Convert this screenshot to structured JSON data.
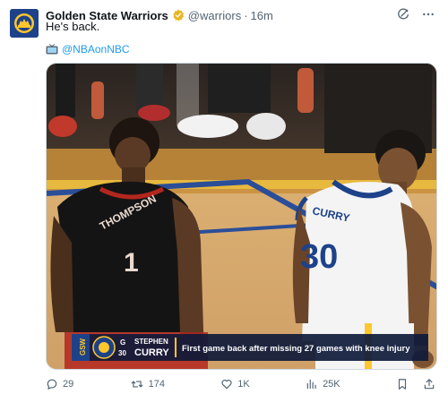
{
  "tweet": {
    "author_name": "Golden State Warriors",
    "author_handle": "@warriors",
    "separator": "·",
    "time": "16m",
    "text": "He's back.",
    "mention": "@NBAonNBC"
  },
  "media": {
    "player_left_name": "THOMPSON",
    "player_left_number": "1",
    "player_right_name": "CURRY",
    "player_right_number": "30",
    "team_tag": "GSW",
    "lower_third_position": "G",
    "lower_third_number": "30",
    "lower_third_first_name": "STEPHEN",
    "lower_third_last_name": "CURRY",
    "lower_third_caption": "First game back after missing 27 games with knee injury"
  },
  "stats": {
    "replies": "29",
    "retweets": "174",
    "likes": "1K",
    "views": "25K"
  },
  "colors": {
    "warriors_blue": "#1d428a",
    "warriors_gold": "#ffc72c",
    "link": "#1d9bf0",
    "muted": "#536471"
  }
}
